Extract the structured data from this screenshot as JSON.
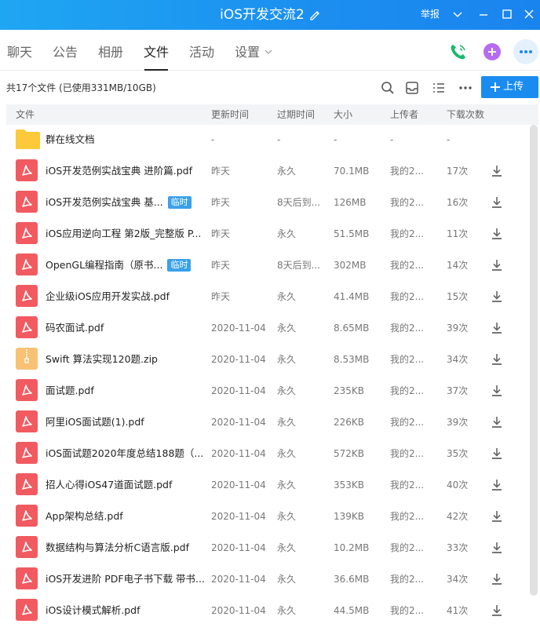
{
  "window": {
    "title": "iOS开发交流2",
    "report_label": "举报",
    "edit_icon": "edit-icon",
    "controls": [
      "chevron-down-icon",
      "minimize-icon",
      "maximize-icon",
      "close-icon"
    ]
  },
  "tabs": [
    {
      "label": "聊天",
      "active": false
    },
    {
      "label": "公告",
      "active": false
    },
    {
      "label": "相册",
      "active": false
    },
    {
      "label": "文件",
      "active": true
    },
    {
      "label": "活动",
      "active": false
    },
    {
      "label": "设置",
      "active": false,
      "dropdown": true
    }
  ],
  "header_actions": [
    "phone-icon",
    "add-app-icon",
    "more-icon"
  ],
  "toolbar": {
    "summary": "共17个文件 (已使用331MB/10GB)",
    "icons": [
      "search-icon",
      "inbox-icon",
      "list-view-icon",
      "more-options-icon"
    ],
    "upload_label": "上传"
  },
  "columns": {
    "file": "文件",
    "updated": "更新时间",
    "expires": "过期时间",
    "size": "大小",
    "uploader": "上传者",
    "downloads": "下载次数"
  },
  "colors": {
    "accent": "#1a8cf0",
    "pdf": "#f15a60",
    "zip": "#f8c173",
    "folder": "#fcc93a",
    "badge": "#3aa1ea"
  },
  "files": [
    {
      "type": "folder",
      "name": "群在线文档",
      "badge": "",
      "updated": "-",
      "expires": "-",
      "size": "-",
      "uploader": "-",
      "downloads": "-",
      "downloadable": false
    },
    {
      "type": "pdf",
      "name": "iOS开发范例实战宝典 进阶篇.pdf",
      "badge": "",
      "updated": "昨天",
      "expires": "永久",
      "size": "70.1MB",
      "uploader": "我的2...",
      "downloads": "17次",
      "downloadable": true
    },
    {
      "type": "pdf",
      "name": "iOS开发范例实战宝典 基...",
      "badge": "临时",
      "updated": "昨天",
      "expires": "8天后到...",
      "size": "126MB",
      "uploader": "我的2...",
      "downloads": "16次",
      "downloadable": true
    },
    {
      "type": "pdf",
      "name": "iOS应用逆向工程 第2版_完整版 P...",
      "badge": "",
      "updated": "昨天",
      "expires": "永久",
      "size": "51.5MB",
      "uploader": "我的2...",
      "downloads": "11次",
      "downloadable": true
    },
    {
      "type": "pdf",
      "name": "OpenGL编程指南（原书...",
      "badge": "临时",
      "updated": "昨天",
      "expires": "8天后到...",
      "size": "302MB",
      "uploader": "我的2...",
      "downloads": "14次",
      "downloadable": true
    },
    {
      "type": "pdf",
      "name": "企业级iOS应用开发实战.pdf",
      "badge": "",
      "updated": "昨天",
      "expires": "永久",
      "size": "41.4MB",
      "uploader": "我的2...",
      "downloads": "15次",
      "downloadable": true
    },
    {
      "type": "pdf",
      "name": "码农面试.pdf",
      "badge": "",
      "updated": "2020-11-04",
      "expires": "永久",
      "size": "8.65MB",
      "uploader": "我的2...",
      "downloads": "39次",
      "downloadable": true
    },
    {
      "type": "zip",
      "name": "Swift 算法实现120题.zip",
      "badge": "",
      "updated": "2020-11-04",
      "expires": "永久",
      "size": "8.53MB",
      "uploader": "我的2...",
      "downloads": "34次",
      "downloadable": true
    },
    {
      "type": "pdf",
      "name": "面试题.pdf",
      "badge": "",
      "updated": "2020-11-04",
      "expires": "永久",
      "size": "235KB",
      "uploader": "我的2...",
      "downloads": "37次",
      "downloadable": true
    },
    {
      "type": "pdf",
      "name": "阿里iOS面试题(1).pdf",
      "badge": "",
      "updated": "2020-11-04",
      "expires": "永久",
      "size": "226KB",
      "uploader": "我的2...",
      "downloads": "39次",
      "downloadable": true
    },
    {
      "type": "pdf",
      "name": "iOS面试题2020年度总结188题（...",
      "badge": "",
      "updated": "2020-11-04",
      "expires": "永久",
      "size": "572KB",
      "uploader": "我的2...",
      "downloads": "35次",
      "downloadable": true
    },
    {
      "type": "pdf",
      "name": "招人心得iOS47道面试题.pdf",
      "badge": "",
      "updated": "2020-11-04",
      "expires": "永久",
      "size": "353KB",
      "uploader": "我的2...",
      "downloads": "40次",
      "downloadable": true
    },
    {
      "type": "pdf",
      "name": "App架构总结.pdf",
      "badge": "",
      "updated": "2020-11-04",
      "expires": "永久",
      "size": "139KB",
      "uploader": "我的2...",
      "downloads": "42次",
      "downloadable": true
    },
    {
      "type": "pdf",
      "name": "数据结构与算法分析C语言版.pdf",
      "badge": "",
      "updated": "2020-11-04",
      "expires": "永久",
      "size": "10.2MB",
      "uploader": "我的2...",
      "downloads": "33次",
      "downloadable": true
    },
    {
      "type": "pdf",
      "name": "iOS开发进阶 PDF电子书下载 带书...",
      "badge": "",
      "updated": "2020-11-04",
      "expires": "永久",
      "size": "36.6MB",
      "uploader": "我的2...",
      "downloads": "34次",
      "downloadable": true
    },
    {
      "type": "pdf",
      "name": "iOS设计模式解析.pdf",
      "badge": "",
      "updated": "2020-11-04",
      "expires": "永久",
      "size": "44.5MB",
      "uploader": "我的2...",
      "downloads": "41次",
      "downloadable": true
    }
  ]
}
